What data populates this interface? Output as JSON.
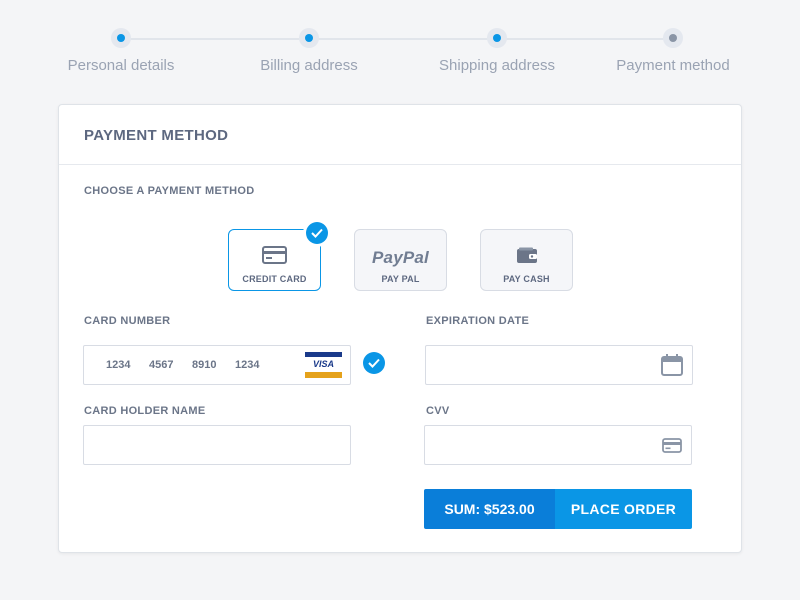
{
  "stepper": {
    "steps": [
      {
        "label": "Personal details",
        "state": "complete"
      },
      {
        "label": "Billing address",
        "state": "complete"
      },
      {
        "label": "Shipping address",
        "state": "complete"
      },
      {
        "label": "Payment method",
        "state": "current"
      }
    ]
  },
  "card": {
    "title": "PAYMENT METHOD",
    "section_label": "CHOOSE A PAYMENT METHOD",
    "methods": [
      {
        "label": "CREDIT CARD",
        "icon": "credit-card-icon",
        "selected": true
      },
      {
        "label": "PAY PAL",
        "logo_text": "PayPal",
        "icon": "paypal-logo",
        "selected": false
      },
      {
        "label": "PAY CASH",
        "icon": "wallet-icon",
        "selected": false
      }
    ],
    "fields": {
      "card_number": {
        "label": "CARD NUMBER",
        "groups": [
          "1234",
          "4567",
          "8910",
          "1234"
        ],
        "brand": "VISA",
        "valid": true
      },
      "expiration": {
        "label": "EXPIRATION DATE",
        "value": "",
        "icon": "calendar-icon"
      },
      "holder": {
        "label": "CARD HOLDER NAME",
        "value": ""
      },
      "cvv": {
        "label": "CVV",
        "value": "",
        "icon": "credit-card-icon"
      }
    },
    "order": {
      "sum_label": "SUM: $523.00",
      "place_label": "PLACE ORDER"
    }
  },
  "colors": {
    "accent": "#0a96e6",
    "accent_dark": "#0a7ed9",
    "text": "#5d6880",
    "muted": "#9aa3b3",
    "border": "#d8dce4"
  }
}
